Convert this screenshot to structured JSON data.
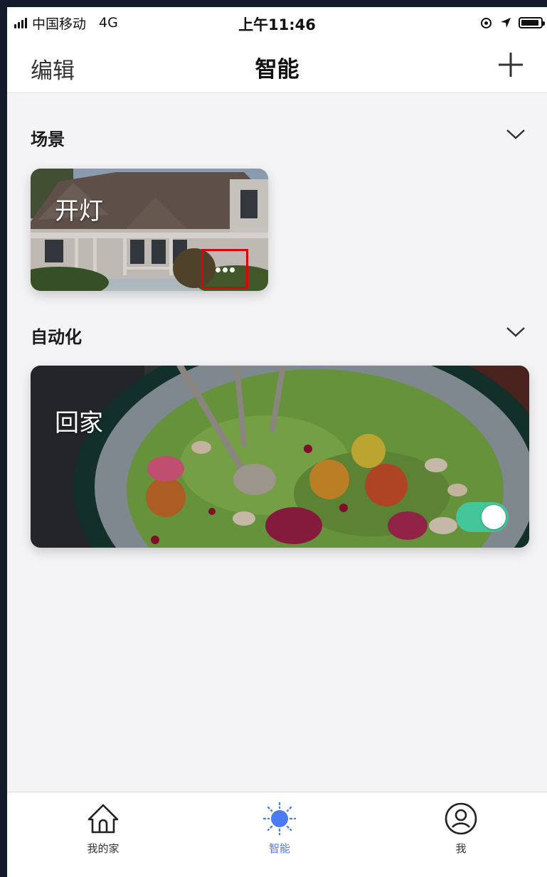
{
  "status_bar": {
    "carrier": "中国移动",
    "network": "4G",
    "time": "上午11:46",
    "icons": [
      "signal-icon",
      "rotation-lock-icon",
      "location-icon",
      "battery-icon"
    ]
  },
  "nav": {
    "edit_label": "编辑",
    "title": "智能",
    "add_icon": "plus-icon"
  },
  "sections": {
    "scenes": {
      "title": "场景",
      "chevron_icon": "chevron-down-icon",
      "cards": [
        {
          "title": "开灯",
          "image": "house-photo",
          "more_icon": "more-dots-icon"
        }
      ]
    },
    "automation": {
      "title": "自动化",
      "chevron_icon": "chevron-down-icon",
      "cards": [
        {
          "title": "回家",
          "image": "salad-bowl-photo",
          "enabled": true
        }
      ]
    }
  },
  "tab_bar": {
    "tabs": [
      {
        "label": "我的家",
        "icon": "home-icon",
        "active": false
      },
      {
        "label": "智能",
        "icon": "sun-icon",
        "active": true
      },
      {
        "label": "我",
        "icon": "user-icon",
        "active": false
      }
    ]
  },
  "colors": {
    "accent_blue": "#4a7bf2",
    "toggle_green": "#45c59a",
    "highlight_red": "#e00000",
    "page_bg": "#f4f4f6"
  }
}
